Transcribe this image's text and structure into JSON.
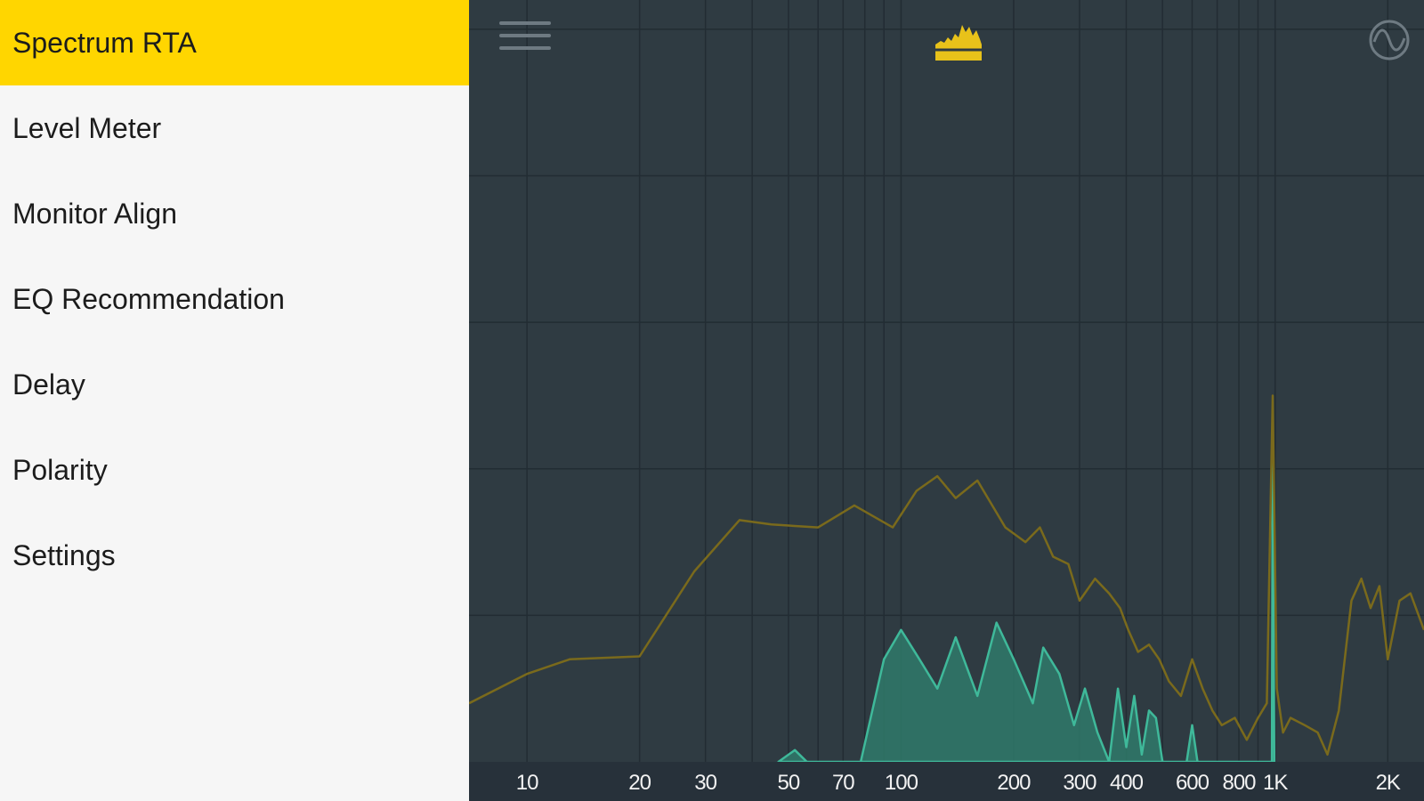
{
  "sidebar": {
    "items": [
      {
        "label": "Spectrum RTA",
        "active": true
      },
      {
        "label": "Level Meter",
        "active": false
      },
      {
        "label": "Monitor Align",
        "active": false
      },
      {
        "label": "EQ Recommendation",
        "active": false
      },
      {
        "label": "Delay",
        "active": false
      },
      {
        "label": "Polarity",
        "active": false
      },
      {
        "label": "Settings",
        "active": false
      }
    ]
  },
  "header": {
    "menu_icon": "hamburger-menu-icon",
    "logo_icon": "spectrum-logo-icon",
    "signal_icon": "sine-wave-icon"
  },
  "colors": {
    "sidebar_bg": "#f6f6f6",
    "active_item": "#ffd600",
    "main_bg": "#2f3b42",
    "grid": "#222c33",
    "axis_bar": "#27313a",
    "peak_line": "#7a6a1c",
    "live_line": "#3fb99a",
    "live_fill": "#2f7a6a",
    "accent_yellow": "#e8c21a"
  },
  "chart_data": {
    "type": "area",
    "xscale": "log",
    "xlim": [
      7,
      2500
    ],
    "ylim": [
      0,
      5.2
    ],
    "xticks": [
      {
        "value": 10,
        "label": "10"
      },
      {
        "value": 20,
        "label": "20"
      },
      {
        "value": 30,
        "label": "30"
      },
      {
        "value": 50,
        "label": "50"
      },
      {
        "value": 70,
        "label": "70"
      },
      {
        "value": 100,
        "label": "100"
      },
      {
        "value": 200,
        "label": "200"
      },
      {
        "value": 300,
        "label": "300"
      },
      {
        "value": 400,
        "label": "400"
      },
      {
        "value": 600,
        "label": "600"
      },
      {
        "value": 800,
        "label": "800"
      },
      {
        "value": 1000,
        "label": "1K"
      },
      {
        "value": 2000,
        "label": "2K"
      }
    ],
    "gridlines_x": [
      10,
      20,
      30,
      40,
      50,
      60,
      70,
      80,
      90,
      100,
      200,
      300,
      400,
      500,
      600,
      700,
      800,
      900,
      1000,
      2000
    ],
    "gridlines_y": [
      1,
      2,
      3,
      4,
      5
    ],
    "series": [
      {
        "kind": "peak-hold",
        "points": [
          [
            7,
            0.4
          ],
          [
            10,
            0.6
          ],
          [
            13,
            0.7
          ],
          [
            20,
            0.72
          ],
          [
            28,
            1.3
          ],
          [
            37,
            1.65
          ],
          [
            45,
            1.62
          ],
          [
            60,
            1.6
          ],
          [
            75,
            1.75
          ],
          [
            95,
            1.6
          ],
          [
            110,
            1.85
          ],
          [
            125,
            1.95
          ],
          [
            140,
            1.8
          ],
          [
            160,
            1.92
          ],
          [
            190,
            1.6
          ],
          [
            215,
            1.5
          ],
          [
            235,
            1.6
          ],
          [
            255,
            1.4
          ],
          [
            280,
            1.35
          ],
          [
            300,
            1.1
          ],
          [
            330,
            1.25
          ],
          [
            360,
            1.15
          ],
          [
            385,
            1.05
          ],
          [
            405,
            0.9
          ],
          [
            430,
            0.75
          ],
          [
            460,
            0.8
          ],
          [
            490,
            0.7
          ],
          [
            520,
            0.55
          ],
          [
            560,
            0.45
          ],
          [
            600,
            0.7
          ],
          [
            640,
            0.5
          ],
          [
            680,
            0.35
          ],
          [
            720,
            0.25
          ],
          [
            780,
            0.3
          ],
          [
            840,
            0.15
          ],
          [
            900,
            0.3
          ],
          [
            950,
            0.4
          ],
          [
            985,
            2.5
          ],
          [
            1010,
            0.5
          ],
          [
            1050,
            0.2
          ],
          [
            1100,
            0.3
          ],
          [
            1200,
            0.25
          ],
          [
            1300,
            0.2
          ],
          [
            1380,
            0.05
          ],
          [
            1480,
            0.35
          ],
          [
            1600,
            1.1
          ],
          [
            1700,
            1.25
          ],
          [
            1800,
            1.05
          ],
          [
            1900,
            1.2
          ],
          [
            2000,
            0.7
          ],
          [
            2150,
            1.1
          ],
          [
            2300,
            1.15
          ],
          [
            2500,
            0.9
          ]
        ]
      },
      {
        "kind": "live",
        "points": [
          [
            47,
            0
          ],
          [
            52,
            0.08
          ],
          [
            56,
            0
          ],
          [
            78,
            0
          ],
          [
            90,
            0.7
          ],
          [
            100,
            0.9
          ],
          [
            112,
            0.7
          ],
          [
            125,
            0.5
          ],
          [
            140,
            0.85
          ],
          [
            160,
            0.45
          ],
          [
            180,
            0.95
          ],
          [
            200,
            0.7
          ],
          [
            225,
            0.4
          ],
          [
            240,
            0.78
          ],
          [
            265,
            0.6
          ],
          [
            290,
            0.25
          ],
          [
            310,
            0.5
          ],
          [
            335,
            0.2
          ],
          [
            360,
            0.0
          ],
          [
            380,
            0.5
          ],
          [
            400,
            0.1
          ],
          [
            420,
            0.45
          ],
          [
            440,
            0.05
          ],
          [
            460,
            0.35
          ],
          [
            480,
            0.3
          ],
          [
            500,
            0.0
          ],
          [
            580,
            0.0
          ],
          [
            600,
            0.25
          ],
          [
            620,
            0.0
          ],
          [
            980,
            0.0
          ],
          [
            985,
            2.2
          ],
          [
            995,
            0.0
          ]
        ]
      }
    ]
  }
}
